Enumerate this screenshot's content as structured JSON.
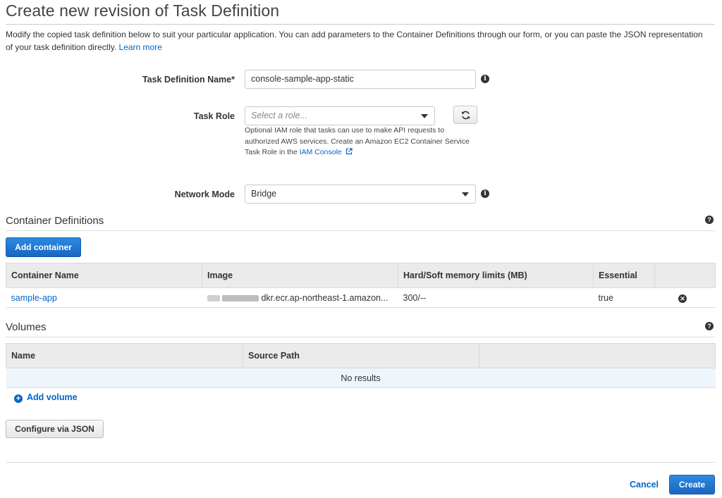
{
  "page": {
    "title": "Create new revision of Task Definition",
    "intro": "Modify the copied task definition below to suit your particular application. You can add parameters to the Container Definitions through our form, or you can paste the JSON representation of your task definition directly.",
    "learn_more": "Learn more"
  },
  "form": {
    "task_definition_name": {
      "label": "Task Definition Name*",
      "value": "console-sample-app-static"
    },
    "task_role": {
      "label": "Task Role",
      "placeholder": "Select a role...",
      "hint": "Optional IAM role that tasks can use to make API requests to authorized AWS services. Create an Amazon EC2 Container Service Task Role in the",
      "hint_link": "IAM Console"
    },
    "network_mode": {
      "label": "Network Mode",
      "value": "Bridge"
    }
  },
  "containers": {
    "title": "Container Definitions",
    "add_button": "Add container",
    "columns": [
      "Container Name",
      "Image",
      "Hard/Soft memory limits (MB)",
      "Essential"
    ],
    "rows": [
      {
        "name": "sample-app",
        "image": "dkr.ecr.ap-northeast-1.amazon...",
        "memory": "300/--",
        "essential": "true"
      }
    ]
  },
  "volumes": {
    "title": "Volumes",
    "columns": [
      "Name",
      "Source Path"
    ],
    "empty": "No results",
    "add_link": "Add volume"
  },
  "actions": {
    "configure_json": "Configure via JSON",
    "cancel": "Cancel",
    "create": "Create"
  },
  "icons": {
    "info": "info-icon",
    "help": "help-icon",
    "refresh": "refresh-icon",
    "external_link": "external-link-icon",
    "remove": "remove-icon",
    "add": "plus-circle-icon"
  },
  "colors": {
    "primary": "#1a73d1",
    "link": "#0066cc"
  }
}
